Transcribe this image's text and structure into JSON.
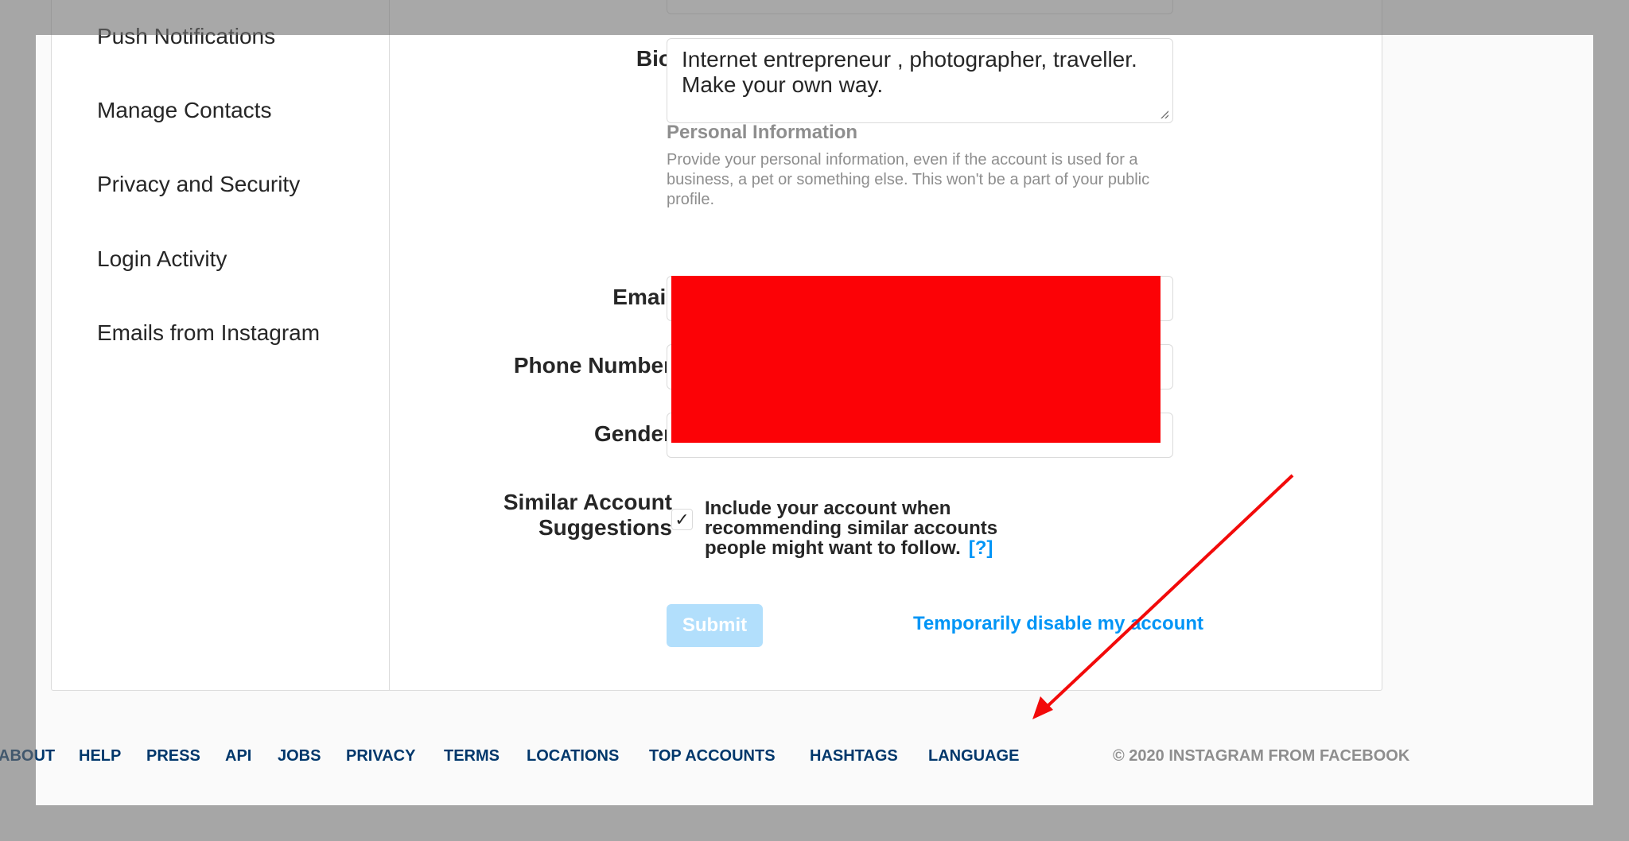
{
  "sidebar": {
    "items": [
      {
        "label": "Push Notifications"
      },
      {
        "label": "Manage Contacts"
      },
      {
        "label": "Privacy and Security"
      },
      {
        "label": "Login Activity"
      },
      {
        "label": "Emails from Instagram"
      }
    ]
  },
  "form": {
    "bio": {
      "label": "Bio",
      "value": "Internet entrepreneur , photographer, traveller. Make your own way."
    },
    "personal_info": {
      "title": "Personal Information",
      "description": "Provide your personal information, even if the account is used for a business, a pet or something else. This won't be a part of your public profile."
    },
    "email": {
      "label": "Email",
      "value": ""
    },
    "phone": {
      "label": "Phone Number",
      "value": ""
    },
    "gender": {
      "label": "Gender",
      "value": ""
    },
    "similar_accounts": {
      "label_line1": "Similar Account",
      "label_line2": "Suggestions",
      "checked": true,
      "check_glyph": "✓",
      "text": "Include your account when recommending similar accounts people might want to follow.",
      "help_label": "[?]"
    },
    "submit_label": "Submit",
    "disable_label": "Temporarily disable my account"
  },
  "footer": {
    "links": [
      "ABOUT",
      "HELP",
      "PRESS",
      "API",
      "JOBS",
      "PRIVACY",
      "TERMS",
      "LOCATIONS",
      "TOP ACCOUNTS",
      "HASHTAGS",
      "LANGUAGE"
    ],
    "copyright": "© 2020 INSTAGRAM FROM FACEBOOK"
  },
  "annotation": {
    "arrow_color": "#f20a0a",
    "redaction_color": "#fc0206"
  },
  "colors": {
    "link_blue": "#0095f6",
    "footer_link": "#00376b",
    "submit_disabled": "#b2dffc"
  }
}
